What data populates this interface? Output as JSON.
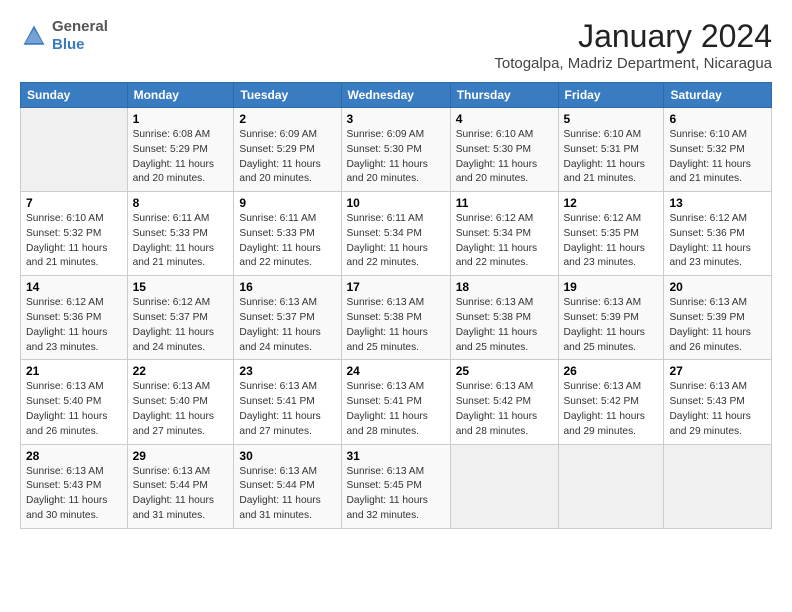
{
  "header": {
    "logo_general": "General",
    "logo_blue": "Blue",
    "month_title": "January 2024",
    "location": "Totogalpa, Madriz Department, Nicaragua"
  },
  "days_of_week": [
    "Sunday",
    "Monday",
    "Tuesday",
    "Wednesday",
    "Thursday",
    "Friday",
    "Saturday"
  ],
  "weeks": [
    [
      {
        "day": "",
        "info": ""
      },
      {
        "day": "1",
        "info": "Sunrise: 6:08 AM\nSunset: 5:29 PM\nDaylight: 11 hours\nand 20 minutes."
      },
      {
        "day": "2",
        "info": "Sunrise: 6:09 AM\nSunset: 5:29 PM\nDaylight: 11 hours\nand 20 minutes."
      },
      {
        "day": "3",
        "info": "Sunrise: 6:09 AM\nSunset: 5:30 PM\nDaylight: 11 hours\nand 20 minutes."
      },
      {
        "day": "4",
        "info": "Sunrise: 6:10 AM\nSunset: 5:30 PM\nDaylight: 11 hours\nand 20 minutes."
      },
      {
        "day": "5",
        "info": "Sunrise: 6:10 AM\nSunset: 5:31 PM\nDaylight: 11 hours\nand 21 minutes."
      },
      {
        "day": "6",
        "info": "Sunrise: 6:10 AM\nSunset: 5:32 PM\nDaylight: 11 hours\nand 21 minutes."
      }
    ],
    [
      {
        "day": "7",
        "info": "Sunrise: 6:10 AM\nSunset: 5:32 PM\nDaylight: 11 hours\nand 21 minutes."
      },
      {
        "day": "8",
        "info": "Sunrise: 6:11 AM\nSunset: 5:33 PM\nDaylight: 11 hours\nand 21 minutes."
      },
      {
        "day": "9",
        "info": "Sunrise: 6:11 AM\nSunset: 5:33 PM\nDaylight: 11 hours\nand 22 minutes."
      },
      {
        "day": "10",
        "info": "Sunrise: 6:11 AM\nSunset: 5:34 PM\nDaylight: 11 hours\nand 22 minutes."
      },
      {
        "day": "11",
        "info": "Sunrise: 6:12 AM\nSunset: 5:34 PM\nDaylight: 11 hours\nand 22 minutes."
      },
      {
        "day": "12",
        "info": "Sunrise: 6:12 AM\nSunset: 5:35 PM\nDaylight: 11 hours\nand 23 minutes."
      },
      {
        "day": "13",
        "info": "Sunrise: 6:12 AM\nSunset: 5:36 PM\nDaylight: 11 hours\nand 23 minutes."
      }
    ],
    [
      {
        "day": "14",
        "info": "Sunrise: 6:12 AM\nSunset: 5:36 PM\nDaylight: 11 hours\nand 23 minutes."
      },
      {
        "day": "15",
        "info": "Sunrise: 6:12 AM\nSunset: 5:37 PM\nDaylight: 11 hours\nand 24 minutes."
      },
      {
        "day": "16",
        "info": "Sunrise: 6:13 AM\nSunset: 5:37 PM\nDaylight: 11 hours\nand 24 minutes."
      },
      {
        "day": "17",
        "info": "Sunrise: 6:13 AM\nSunset: 5:38 PM\nDaylight: 11 hours\nand 25 minutes."
      },
      {
        "day": "18",
        "info": "Sunrise: 6:13 AM\nSunset: 5:38 PM\nDaylight: 11 hours\nand 25 minutes."
      },
      {
        "day": "19",
        "info": "Sunrise: 6:13 AM\nSunset: 5:39 PM\nDaylight: 11 hours\nand 25 minutes."
      },
      {
        "day": "20",
        "info": "Sunrise: 6:13 AM\nSunset: 5:39 PM\nDaylight: 11 hours\nand 26 minutes."
      }
    ],
    [
      {
        "day": "21",
        "info": "Sunrise: 6:13 AM\nSunset: 5:40 PM\nDaylight: 11 hours\nand 26 minutes."
      },
      {
        "day": "22",
        "info": "Sunrise: 6:13 AM\nSunset: 5:40 PM\nDaylight: 11 hours\nand 27 minutes."
      },
      {
        "day": "23",
        "info": "Sunrise: 6:13 AM\nSunset: 5:41 PM\nDaylight: 11 hours\nand 27 minutes."
      },
      {
        "day": "24",
        "info": "Sunrise: 6:13 AM\nSunset: 5:41 PM\nDaylight: 11 hours\nand 28 minutes."
      },
      {
        "day": "25",
        "info": "Sunrise: 6:13 AM\nSunset: 5:42 PM\nDaylight: 11 hours\nand 28 minutes."
      },
      {
        "day": "26",
        "info": "Sunrise: 6:13 AM\nSunset: 5:42 PM\nDaylight: 11 hours\nand 29 minutes."
      },
      {
        "day": "27",
        "info": "Sunrise: 6:13 AM\nSunset: 5:43 PM\nDaylight: 11 hours\nand 29 minutes."
      }
    ],
    [
      {
        "day": "28",
        "info": "Sunrise: 6:13 AM\nSunset: 5:43 PM\nDaylight: 11 hours\nand 30 minutes."
      },
      {
        "day": "29",
        "info": "Sunrise: 6:13 AM\nSunset: 5:44 PM\nDaylight: 11 hours\nand 31 minutes."
      },
      {
        "day": "30",
        "info": "Sunrise: 6:13 AM\nSunset: 5:44 PM\nDaylight: 11 hours\nand 31 minutes."
      },
      {
        "day": "31",
        "info": "Sunrise: 6:13 AM\nSunset: 5:45 PM\nDaylight: 11 hours\nand 32 minutes."
      },
      {
        "day": "",
        "info": ""
      },
      {
        "day": "",
        "info": ""
      },
      {
        "day": "",
        "info": ""
      }
    ]
  ]
}
